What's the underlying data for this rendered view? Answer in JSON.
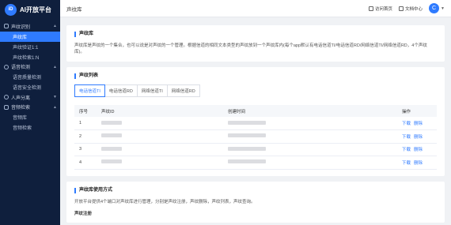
{
  "brand": {
    "logo_mark": "iD",
    "name": "AI开放平台"
  },
  "sidebar": {
    "groups": [
      {
        "label": "声纹识别",
        "items": [
          {
            "label": "声纹库",
            "active": true
          },
          {
            "label": "声纹验证1:1"
          },
          {
            "label": "声纹检索1:N"
          }
        ]
      },
      {
        "label": "语音检测",
        "items": [
          {
            "label": "语音质量检测"
          },
          {
            "label": "语音安全检测"
          }
        ]
      },
      {
        "label": "人声分离",
        "items": []
      },
      {
        "label": "音频检索",
        "items": [
          {
            "label": "音频库"
          },
          {
            "label": "音频检索"
          }
        ]
      }
    ]
  },
  "header": {
    "title": "声纹库",
    "links": [
      {
        "label": "访问首页",
        "icon": "home-icon"
      },
      {
        "label": "文档中心",
        "icon": "doc-icon"
      }
    ],
    "avatar_letter": "C"
  },
  "intro": {
    "title": "声纹库",
    "desc": "声纹库是声纹的一个集合，也可以说是对声纹的一个管理。根据信道的相同文本类型的声纹放到一个声纹库内(每个app默认有电话信道TI/电话信道RD/网络信道TI/网络信道RD，4个声纹库)。"
  },
  "list": {
    "title": "声纹列表",
    "tabs": [
      "电话信道TI",
      "电话信道RD",
      "网络信道TI",
      "网络信道RD"
    ],
    "active_tab": 0,
    "columns": [
      "序号",
      "声纹ID",
      "创建时间",
      "操作"
    ],
    "rows": [
      {
        "index": "1"
      },
      {
        "index": "2"
      },
      {
        "index": "3"
      },
      {
        "index": "4"
      }
    ],
    "download_label": "下载",
    "delete_label": "删除"
  },
  "usage": {
    "title": "声纹库使用方式",
    "desc": "开放平台提供4个端口对声纹库进行管理，分别是声纹注册，声纹删除，声纹列表，声纹查询。",
    "subhead": "声纹注册"
  }
}
